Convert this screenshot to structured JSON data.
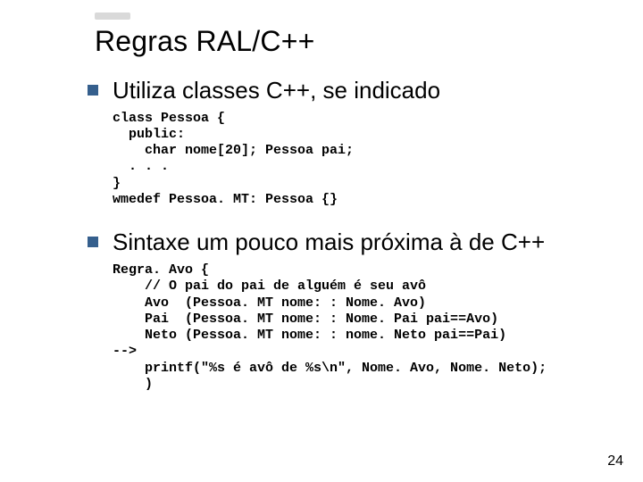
{
  "title": "Regras RAL/C++",
  "bullets": [
    {
      "text": "Utiliza classes C++, se indicado"
    },
    {
      "text": "Sintaxe um pouco mais próxima à de C++"
    }
  ],
  "code": [
    "class Pessoa {\n  public:\n    char nome[20]; Pessoa pai;\n  . . .\n}\nwmedef Pessoa. MT: Pessoa {}",
    "Regra. Avo {\n    // O pai do pai de alguém é seu avô\n    Avo  (Pessoa. MT nome: : Nome. Avo)\n    Pai  (Pessoa. MT nome: : Nome. Pai pai==Avo)\n    Neto (Pessoa. MT nome: : nome. Neto pai==Pai)\n-->\n    printf(\"%s é avô de %s\\n\", Nome. Avo, Nome. Neto);\n    )"
  ],
  "pageNumber": "24"
}
